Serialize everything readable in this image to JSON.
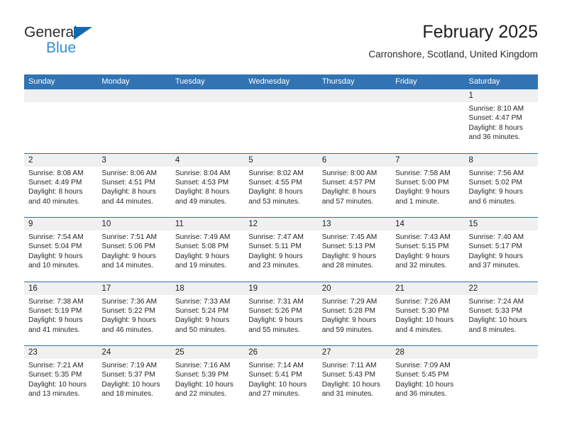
{
  "brand": {
    "name_part1": "General",
    "name_part2": "Blue",
    "triangle_color": "#1168b3",
    "blue_color": "#2f8fd6"
  },
  "header": {
    "title": "February 2025",
    "subtitle": "Carronshore, Scotland, United Kingdom",
    "header_bg": "#3173b3"
  },
  "weekdays": [
    "Sunday",
    "Monday",
    "Tuesday",
    "Wednesday",
    "Thursday",
    "Friday",
    "Saturday"
  ],
  "weeks": [
    [
      {
        "day": "",
        "sunrise": "",
        "sunset": "",
        "daylight1": "",
        "daylight2": ""
      },
      {
        "day": "",
        "sunrise": "",
        "sunset": "",
        "daylight1": "",
        "daylight2": ""
      },
      {
        "day": "",
        "sunrise": "",
        "sunset": "",
        "daylight1": "",
        "daylight2": ""
      },
      {
        "day": "",
        "sunrise": "",
        "sunset": "",
        "daylight1": "",
        "daylight2": ""
      },
      {
        "day": "",
        "sunrise": "",
        "sunset": "",
        "daylight1": "",
        "daylight2": ""
      },
      {
        "day": "",
        "sunrise": "",
        "sunset": "",
        "daylight1": "",
        "daylight2": ""
      },
      {
        "day": "1",
        "sunrise": "Sunrise: 8:10 AM",
        "sunset": "Sunset: 4:47 PM",
        "daylight1": "Daylight: 8 hours",
        "daylight2": "and 36 minutes."
      }
    ],
    [
      {
        "day": "2",
        "sunrise": "Sunrise: 8:08 AM",
        "sunset": "Sunset: 4:49 PM",
        "daylight1": "Daylight: 8 hours",
        "daylight2": "and 40 minutes."
      },
      {
        "day": "3",
        "sunrise": "Sunrise: 8:06 AM",
        "sunset": "Sunset: 4:51 PM",
        "daylight1": "Daylight: 8 hours",
        "daylight2": "and 44 minutes."
      },
      {
        "day": "4",
        "sunrise": "Sunrise: 8:04 AM",
        "sunset": "Sunset: 4:53 PM",
        "daylight1": "Daylight: 8 hours",
        "daylight2": "and 49 minutes."
      },
      {
        "day": "5",
        "sunrise": "Sunrise: 8:02 AM",
        "sunset": "Sunset: 4:55 PM",
        "daylight1": "Daylight: 8 hours",
        "daylight2": "and 53 minutes."
      },
      {
        "day": "6",
        "sunrise": "Sunrise: 8:00 AM",
        "sunset": "Sunset: 4:57 PM",
        "daylight1": "Daylight: 8 hours",
        "daylight2": "and 57 minutes."
      },
      {
        "day": "7",
        "sunrise": "Sunrise: 7:58 AM",
        "sunset": "Sunset: 5:00 PM",
        "daylight1": "Daylight: 9 hours",
        "daylight2": "and 1 minute."
      },
      {
        "day": "8",
        "sunrise": "Sunrise: 7:56 AM",
        "sunset": "Sunset: 5:02 PM",
        "daylight1": "Daylight: 9 hours",
        "daylight2": "and 6 minutes."
      }
    ],
    [
      {
        "day": "9",
        "sunrise": "Sunrise: 7:54 AM",
        "sunset": "Sunset: 5:04 PM",
        "daylight1": "Daylight: 9 hours",
        "daylight2": "and 10 minutes."
      },
      {
        "day": "10",
        "sunrise": "Sunrise: 7:51 AM",
        "sunset": "Sunset: 5:06 PM",
        "daylight1": "Daylight: 9 hours",
        "daylight2": "and 14 minutes."
      },
      {
        "day": "11",
        "sunrise": "Sunrise: 7:49 AM",
        "sunset": "Sunset: 5:08 PM",
        "daylight1": "Daylight: 9 hours",
        "daylight2": "and 19 minutes."
      },
      {
        "day": "12",
        "sunrise": "Sunrise: 7:47 AM",
        "sunset": "Sunset: 5:11 PM",
        "daylight1": "Daylight: 9 hours",
        "daylight2": "and 23 minutes."
      },
      {
        "day": "13",
        "sunrise": "Sunrise: 7:45 AM",
        "sunset": "Sunset: 5:13 PM",
        "daylight1": "Daylight: 9 hours",
        "daylight2": "and 28 minutes."
      },
      {
        "day": "14",
        "sunrise": "Sunrise: 7:43 AM",
        "sunset": "Sunset: 5:15 PM",
        "daylight1": "Daylight: 9 hours",
        "daylight2": "and 32 minutes."
      },
      {
        "day": "15",
        "sunrise": "Sunrise: 7:40 AM",
        "sunset": "Sunset: 5:17 PM",
        "daylight1": "Daylight: 9 hours",
        "daylight2": "and 37 minutes."
      }
    ],
    [
      {
        "day": "16",
        "sunrise": "Sunrise: 7:38 AM",
        "sunset": "Sunset: 5:19 PM",
        "daylight1": "Daylight: 9 hours",
        "daylight2": "and 41 minutes."
      },
      {
        "day": "17",
        "sunrise": "Sunrise: 7:36 AM",
        "sunset": "Sunset: 5:22 PM",
        "daylight1": "Daylight: 9 hours",
        "daylight2": "and 46 minutes."
      },
      {
        "day": "18",
        "sunrise": "Sunrise: 7:33 AM",
        "sunset": "Sunset: 5:24 PM",
        "daylight1": "Daylight: 9 hours",
        "daylight2": "and 50 minutes."
      },
      {
        "day": "19",
        "sunrise": "Sunrise: 7:31 AM",
        "sunset": "Sunset: 5:26 PM",
        "daylight1": "Daylight: 9 hours",
        "daylight2": "and 55 minutes."
      },
      {
        "day": "20",
        "sunrise": "Sunrise: 7:29 AM",
        "sunset": "Sunset: 5:28 PM",
        "daylight1": "Daylight: 9 hours",
        "daylight2": "and 59 minutes."
      },
      {
        "day": "21",
        "sunrise": "Sunrise: 7:26 AM",
        "sunset": "Sunset: 5:30 PM",
        "daylight1": "Daylight: 10 hours",
        "daylight2": "and 4 minutes."
      },
      {
        "day": "22",
        "sunrise": "Sunrise: 7:24 AM",
        "sunset": "Sunset: 5:33 PM",
        "daylight1": "Daylight: 10 hours",
        "daylight2": "and 8 minutes."
      }
    ],
    [
      {
        "day": "23",
        "sunrise": "Sunrise: 7:21 AM",
        "sunset": "Sunset: 5:35 PM",
        "daylight1": "Daylight: 10 hours",
        "daylight2": "and 13 minutes."
      },
      {
        "day": "24",
        "sunrise": "Sunrise: 7:19 AM",
        "sunset": "Sunset: 5:37 PM",
        "daylight1": "Daylight: 10 hours",
        "daylight2": "and 18 minutes."
      },
      {
        "day": "25",
        "sunrise": "Sunrise: 7:16 AM",
        "sunset": "Sunset: 5:39 PM",
        "daylight1": "Daylight: 10 hours",
        "daylight2": "and 22 minutes."
      },
      {
        "day": "26",
        "sunrise": "Sunrise: 7:14 AM",
        "sunset": "Sunset: 5:41 PM",
        "daylight1": "Daylight: 10 hours",
        "daylight2": "and 27 minutes."
      },
      {
        "day": "27",
        "sunrise": "Sunrise: 7:11 AM",
        "sunset": "Sunset: 5:43 PM",
        "daylight1": "Daylight: 10 hours",
        "daylight2": "and 31 minutes."
      },
      {
        "day": "28",
        "sunrise": "Sunrise: 7:09 AM",
        "sunset": "Sunset: 5:45 PM",
        "daylight1": "Daylight: 10 hours",
        "daylight2": "and 36 minutes."
      },
      {
        "day": "",
        "sunrise": "",
        "sunset": "",
        "daylight1": "",
        "daylight2": ""
      }
    ]
  ]
}
